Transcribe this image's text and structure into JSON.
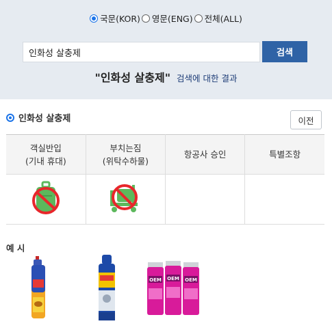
{
  "search": {
    "lang_options": [
      "국문(KOR)",
      "영문(ENG)",
      "전체(ALL)"
    ],
    "selected_lang": "국문(KOR)",
    "input_value": "인화성 살충제",
    "button_label": "검색"
  },
  "result": {
    "query_display": "\"인화성 살충제\"",
    "suffix": "검색에 대한 결과"
  },
  "section": {
    "title": "인화성 살충제",
    "prev_label": "이전"
  },
  "table": {
    "headers": [
      {
        "line1": "객실반입",
        "line2": "(기내 휴대)"
      },
      {
        "line1": "부치는짐",
        "line2": "(위탁수하물)"
      },
      {
        "line1": "항공사 승인",
        "line2": ""
      },
      {
        "line1": "특별조항",
        "line2": ""
      }
    ],
    "cells": [
      "carry-on-prohibited-icon",
      "checked-baggage-prohibited-icon",
      "",
      ""
    ]
  },
  "examples": {
    "label": "예 시",
    "items": [
      "insecticide-spray-can-1",
      "insecticide-spray-can-2",
      "oem-spray-cans"
    ]
  },
  "colors": {
    "panel_bg": "#e6ebf1",
    "button_blue": "#2f63a6",
    "prohibit_red": "#e8262b",
    "bag_green": "#5cb85c"
  }
}
